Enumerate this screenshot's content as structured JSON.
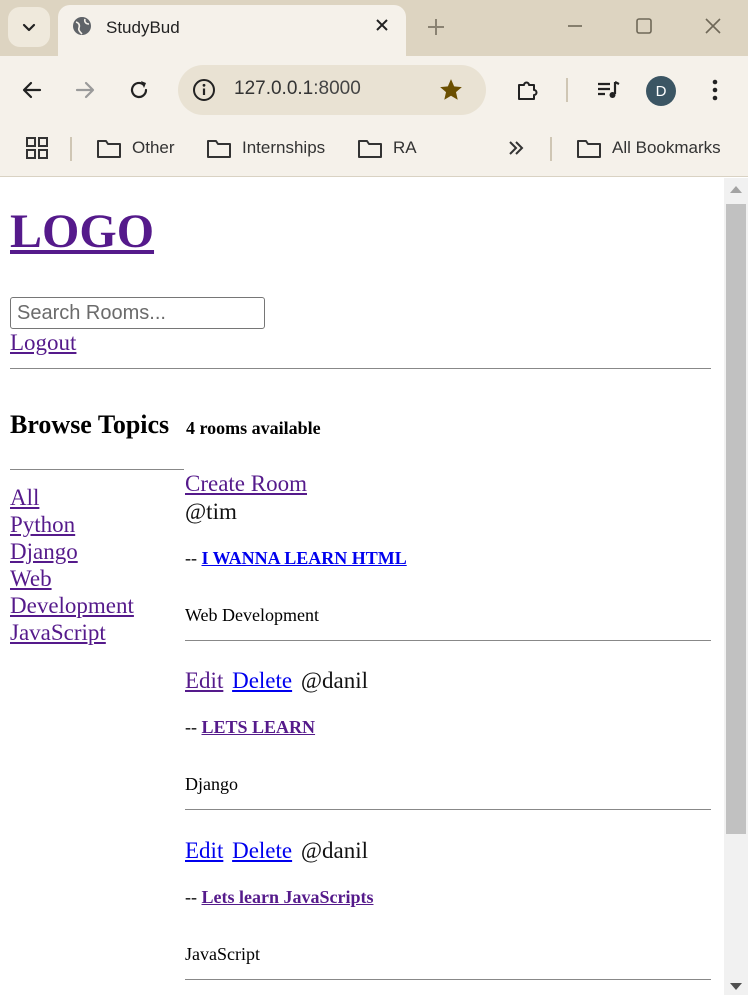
{
  "browser": {
    "tab_title": "StudyBud",
    "url_host": "127.0.0.1",
    "url_port": ":8000",
    "profile_initial": "D",
    "bookmarks": [
      "Other",
      "Internships",
      "RA"
    ],
    "all_bookmarks": "All Bookmarks"
  },
  "page": {
    "logo": "LOGO",
    "search_placeholder": "Search Rooms...",
    "logout": "Logout",
    "browse_title": "Browse Topics",
    "rooms_count": "4 rooms available",
    "create_room": "Create Room",
    "topics": [
      "All",
      "Python",
      "Django",
      "Web",
      "Development",
      "JavaScript"
    ],
    "rooms": [
      {
        "host": "@tim",
        "title": "I WANNA LEARN HTML",
        "topic": "Web Development",
        "edit": "",
        "delete": "",
        "dash": "--"
      },
      {
        "host": "@danil",
        "title": "LETS LEARN",
        "topic": "Django",
        "edit": "Edit",
        "delete": "Delete",
        "dash": "--"
      },
      {
        "host": "@danil",
        "title": "Lets learn JavaScripts",
        "topic": "JavaScript",
        "edit": "Edit",
        "delete": "Delete",
        "dash": "--"
      }
    ]
  }
}
